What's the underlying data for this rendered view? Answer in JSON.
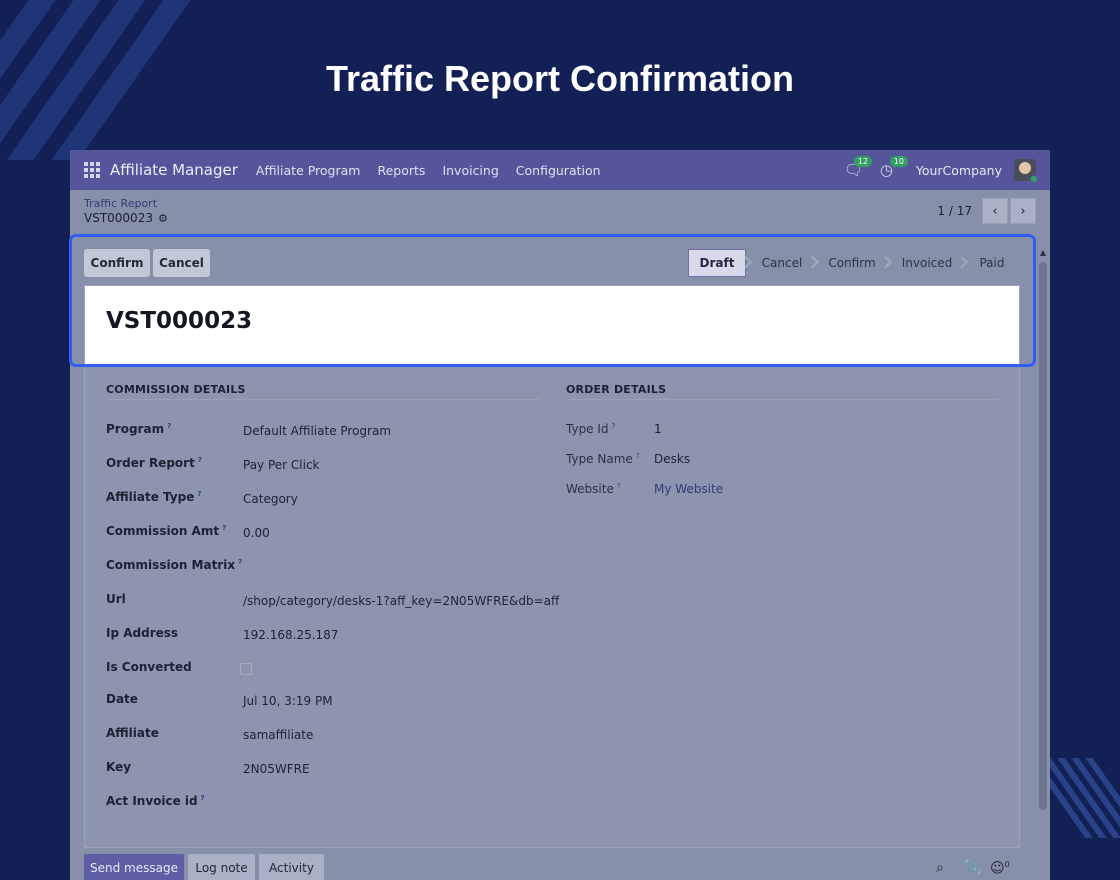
{
  "headline": "Traffic Report Confirmation",
  "navbar": {
    "brand": "Affiliate Manager",
    "menu": [
      "Affiliate Program",
      "Reports",
      "Invoicing",
      "Configuration"
    ],
    "messages_count": "12",
    "activities_count": "10",
    "company": "YourCompany"
  },
  "control": {
    "breadcrumb": "Traffic Report",
    "record_name": "VST000023",
    "pager": "1 / 17"
  },
  "actions": {
    "confirm": "Confirm",
    "cancel": "Cancel"
  },
  "stages": [
    "Draft",
    "Cancel",
    "Confirm",
    "Invoiced",
    "Paid"
  ],
  "active_stage": "Draft",
  "record": {
    "title": "VST000023",
    "commission": {
      "heading": "COMMISSION DETAILS",
      "program_label": "Program",
      "program": "Default Affiliate Program",
      "order_report_label": "Order Report",
      "order_report": "Pay Per Click",
      "affiliate_type_label": "Affiliate Type",
      "affiliate_type": "Category",
      "commission_amt_label": "Commission Amt",
      "commission_amt": "0.00",
      "commission_matrix_label": "Commission Matrix",
      "url_label": "Url",
      "url": "/shop/category/desks-1?aff_key=2N05WFRE&db=aff",
      "ip_label": "Ip Address",
      "ip": "192.168.25.187",
      "converted_label": "Is Converted",
      "date_label": "Date",
      "date": "Jul 10, 3:19 PM",
      "affiliate_label": "Affiliate",
      "affiliate": "samaffiliate",
      "key_label": "Key",
      "key": "2N05WFRE",
      "act_invoice_label": "Act Invoice id"
    },
    "order": {
      "heading": "ORDER DETAILS",
      "type_id_label": "Type Id",
      "type_id": "1",
      "type_name_label": "Type Name",
      "type_name": "Desks",
      "website_label": "Website",
      "website": "My Website"
    }
  },
  "chatter": {
    "send_message": "Send message",
    "log_note": "Log note",
    "activity": "Activity",
    "followers_count": "0"
  },
  "colors": {
    "background": "#122055",
    "navbar": "#54559a",
    "highlight": "#2f5df5"
  }
}
